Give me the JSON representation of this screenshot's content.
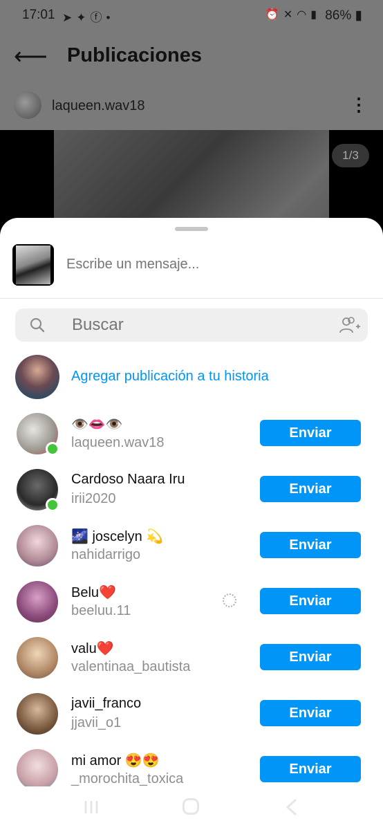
{
  "status_bar": {
    "time": "17:01",
    "left_icons": [
      "telegram-icon",
      "twitter-icon",
      "facebook-icon",
      "dot-icon"
    ],
    "right_icons": [
      "alarm-icon",
      "mute-icon",
      "wifi-icon",
      "signal-icon"
    ],
    "battery": "86%"
  },
  "appbar": {
    "title": "Publicaciones"
  },
  "post": {
    "username": "laqueen.wav18",
    "page_counter": "1/3"
  },
  "message": {
    "placeholder": "Escribe un mensaje..."
  },
  "search": {
    "placeholder": "Buscar"
  },
  "story": {
    "label": "Agregar publicación a tu historia"
  },
  "contacts": [
    {
      "name": "👁️👄👁️",
      "username": "laqueen.wav18",
      "online": true,
      "button": "Enviar"
    },
    {
      "name": "Cardoso Naara Iru",
      "username": "irii2020",
      "online": true,
      "button": "Enviar"
    },
    {
      "name": "🌌 joscelyn 💫",
      "username": "nahidarrigo",
      "online": false,
      "button": "Enviar"
    },
    {
      "name": "Belu❤️",
      "username": "beeluu.11",
      "online": false,
      "button": "Enviar",
      "loading": true
    },
    {
      "name": "valu❤️",
      "username": "valentinaa_bautista",
      "online": false,
      "button": "Enviar"
    },
    {
      "name": "javii_franco",
      "username": "jjavii_o1",
      "online": false,
      "button": "Enviar"
    },
    {
      "name": "mi amor 😍😍",
      "username": "_morochita_toxica",
      "online": false,
      "button": "Enviar"
    }
  ],
  "colors": {
    "accent": "#0095f6",
    "online": "#44c43a"
  }
}
